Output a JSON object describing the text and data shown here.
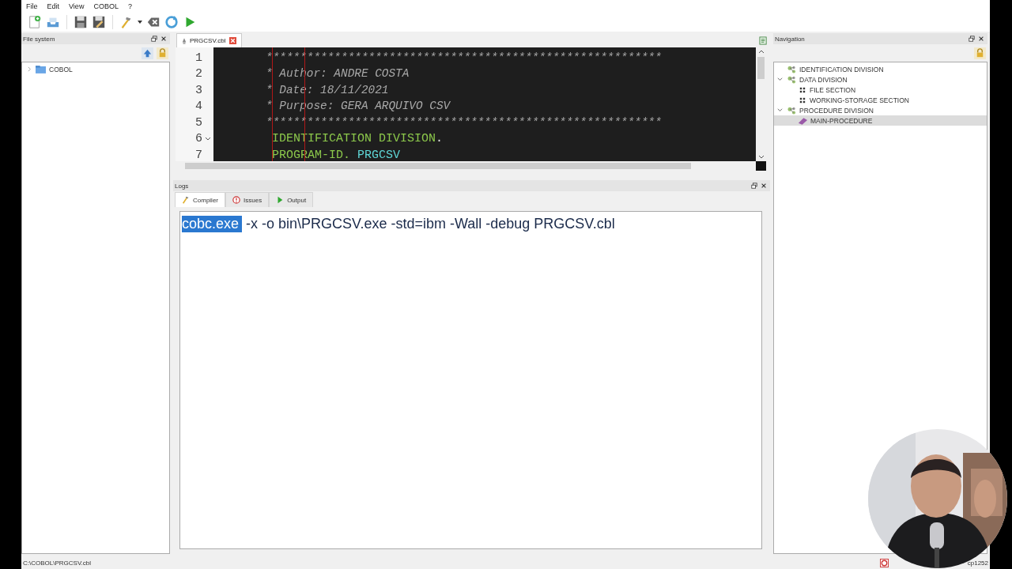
{
  "menu": [
    "File",
    "Edit",
    "View",
    "COBOL",
    "?"
  ],
  "file_system": {
    "title": "File system",
    "tree": [
      {
        "label": "COBOL",
        "expanded": false
      }
    ]
  },
  "editor": {
    "tabs": [
      {
        "label": "PRGCSV.cbl",
        "selected": true
      }
    ],
    "lines": [
      {
        "number": "1",
        "fold": false,
        "tokens": [
          {
            "kind": "comment",
            "text": "**********************************************************"
          }
        ]
      },
      {
        "number": "2",
        "fold": false,
        "tokens": [
          {
            "kind": "comment",
            "text": "* Author: ANDRE COSTA"
          }
        ]
      },
      {
        "number": "3",
        "fold": false,
        "tokens": [
          {
            "kind": "comment",
            "text": "* Date: 18/11/2021"
          }
        ]
      },
      {
        "number": "4",
        "fold": false,
        "tokens": [
          {
            "kind": "comment",
            "text": "* Purpose: GERA ARQUIVO CSV"
          }
        ]
      },
      {
        "number": "5",
        "fold": false,
        "tokens": [
          {
            "kind": "comment",
            "text": "**********************************************************"
          }
        ]
      },
      {
        "number": "6",
        "fold": true,
        "tokens": [
          {
            "kind": "keyword",
            "text": "IDENTIFICATION DIVISION"
          },
          {
            "kind": "punct",
            "text": "."
          }
        ]
      },
      {
        "number": "7",
        "fold": false,
        "tokens": [
          {
            "kind": "keyword",
            "text": "PROGRAM-ID."
          },
          {
            "kind": "name",
            "text": " PRGCSV"
          }
        ]
      }
    ]
  },
  "logs": {
    "title": "Logs",
    "tabs": [
      {
        "label": "Compiler",
        "kind": "compiler",
        "selected": true
      },
      {
        "label": "Issues",
        "kind": "issues",
        "selected": false
      },
      {
        "label": "Output",
        "kind": "output",
        "selected": false
      }
    ],
    "text": [
      {
        "text": "cobc.exe",
        "selected": true
      },
      {
        "text": "-x -o bin\\PRGCSV.exe -std=ibm -Wall -debug PRGCSV.cbl",
        "selected": false
      }
    ]
  },
  "navigation": {
    "title": "Navigation",
    "tree": [
      {
        "label": "IDENTIFICATION DIVISION",
        "kind": "division",
        "selected": false
      },
      {
        "label": "DATA DIVISION",
        "kind": "division",
        "selected": false,
        "expanded": true,
        "children": [
          {
            "label": "FILE SECTION",
            "kind": "section",
            "selected": false
          },
          {
            "label": "WORKING-STORAGE SECTION",
            "kind": "section",
            "selected": false
          }
        ]
      },
      {
        "label": "PROCEDURE DIVISION",
        "kind": "division",
        "selected": false,
        "expanded": true,
        "children": [
          {
            "label": "MAIN-PROCEDURE",
            "kind": "procedure",
            "selected": true
          }
        ]
      }
    ]
  },
  "status_bar": {
    "path": "C:\\COBOL\\PRGCSV.cbl",
    "encoding": "cp1252"
  }
}
